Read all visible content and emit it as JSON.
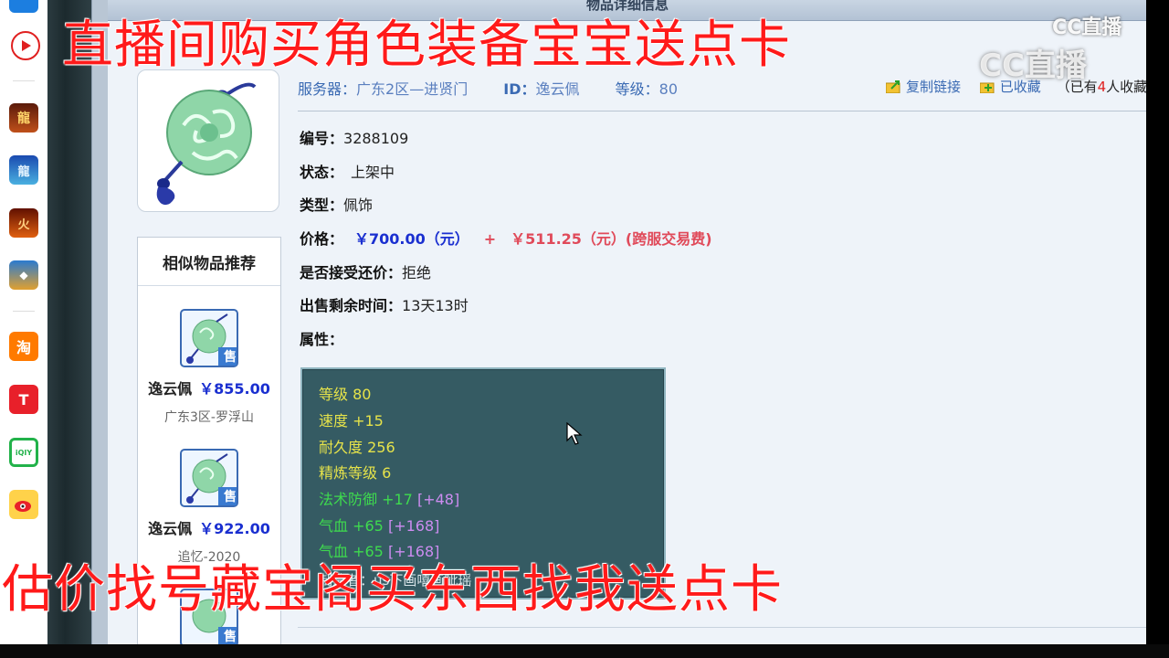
{
  "overlay": {
    "top_caption": "直播间购买角色装备宝宝送点卡",
    "bottom_caption": "估价找号藏宝阁买东西找我送点卡",
    "watermark_small": "CC直播",
    "watermark_big": "CC直播"
  },
  "page": {
    "title_bar": "物品详细信息"
  },
  "header": {
    "server_label": "服务器：",
    "server_value": "广东2区—进贤门",
    "id_label": "ID：",
    "id_value": "逸云佩",
    "level_label": "等级：",
    "level_value": "80",
    "copy_link": "复制链接",
    "favorited": "已收藏",
    "fav_count_prefix": "（已有",
    "fav_count": "4",
    "fav_count_suffix": "人收藏"
  },
  "details": {
    "number_label": "编号：",
    "number_value": "3288109",
    "status_label": "状态：",
    "status_value": "上架中",
    "type_label": "类型：",
    "type_value": "佩饰",
    "price_label": "价格：",
    "price_value": "￥700.00（元）",
    "price_plus": "+",
    "price_fee": "￥511.25（元）(跨服交易费)",
    "counter_label": "是否接受还价：",
    "counter_value": "拒绝",
    "remaining_label": "出售剩余时间：",
    "remaining_value": "13天13时",
    "attr_label": "属性："
  },
  "attributes": {
    "lines": [
      {
        "text": "等级 80"
      },
      {
        "text": "速度 +15"
      },
      {
        "text": "耐久度 256"
      },
      {
        "text": "精炼等级 6"
      },
      {
        "text": "法术防御 +17",
        "extra": "[+48]"
      },
      {
        "text": "气血 +65",
        "extra": "[+168]"
      },
      {
        "text": "气血 +65",
        "extra": "[+168]"
      }
    ],
    "seller": "制造者：us下画嘻画眦瑶"
  },
  "sidebar": {
    "title": "相似物品推荐",
    "badge": "售",
    "items": [
      {
        "name": "逸云佩",
        "price": "￥855.00",
        "server": "广东3区-罗浮山"
      },
      {
        "name": "逸云佩",
        "price": "￥922.00",
        "server": "追忆-2020"
      }
    ]
  },
  "taskbar": {
    "icons": [
      "video-player-icon",
      "game-icon-1",
      "game-icon-2",
      "game-icon-3",
      "game-icon-4",
      "taobao-icon",
      "toutiao-icon",
      "iqiyi-icon",
      "weibo-icon"
    ],
    "taobao_glyph": "淘",
    "toutiao_glyph": "T",
    "iqiyi_glyph": "iQIY"
  }
}
